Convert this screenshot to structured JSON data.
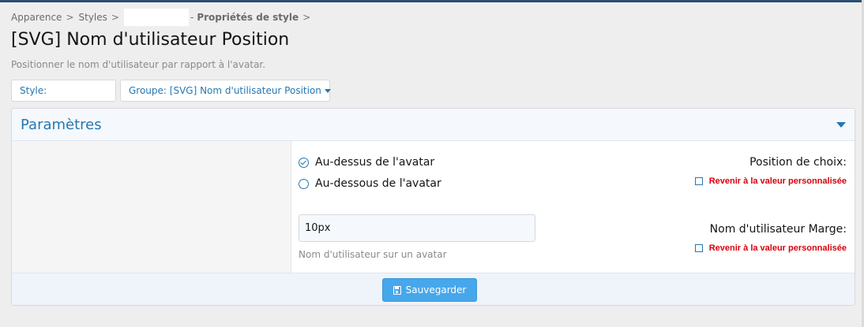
{
  "breadcrumb": {
    "items": [
      "Apparence",
      "Styles",
      "Propriétés de style"
    ],
    "separator": ">"
  },
  "page": {
    "title": "[SVG] Nom d'utilisateur Position",
    "description": "Positionner le nom d'utilisateur par rapport à l'avatar."
  },
  "filters": {
    "style_label": "Style:",
    "group_label": "Groupe: [SVG] Nom d'utilisateur Position"
  },
  "block": {
    "title": "Paramètres"
  },
  "fields": {
    "position": {
      "label": "Position de choix:",
      "revert": "Revenir à la valeur personnalisée",
      "options": [
        "Au-dessus de l'avatar",
        "Au-dessous de l'avatar"
      ],
      "selected": "Au-dessus de l'avatar"
    },
    "margin": {
      "label": "Nom d'utilisateur Marge:",
      "revert": "Revenir à la valeur personnalisée",
      "value": "10px",
      "hint": "Nom d'utilisateur sur un avatar"
    }
  },
  "footer": {
    "save_label": "Sauvegarder"
  },
  "colors": {
    "accent": "#2577b1",
    "button": "#47a7eb",
    "revert": "#d8000c"
  }
}
